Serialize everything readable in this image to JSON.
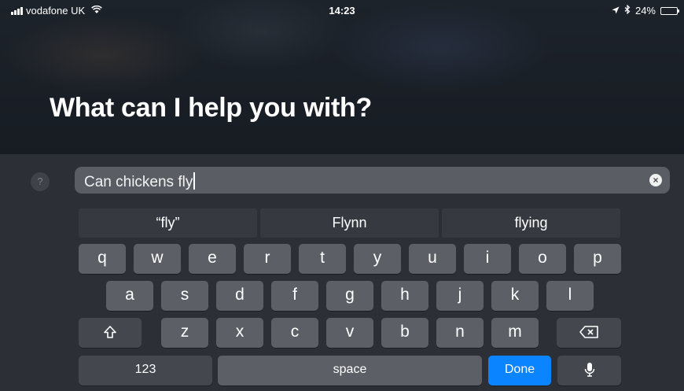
{
  "status_bar": {
    "carrier": "vodafone UK",
    "time": "14:23",
    "battery_percent": "24%",
    "battery_level": 0.24,
    "icons": [
      "signal-icon",
      "wifi-icon",
      "location-icon",
      "bluetooth-icon",
      "battery-icon"
    ]
  },
  "siri": {
    "prompt": "What can I help you with?",
    "help_glyph": "?",
    "search_text": "Can chickens fly"
  },
  "suggestions": [
    "“fly”",
    "Flynn",
    "flying"
  ],
  "keyboard": {
    "row1": [
      "q",
      "w",
      "e",
      "r",
      "t",
      "y",
      "u",
      "i",
      "o",
      "p"
    ],
    "row2": [
      "a",
      "s",
      "d",
      "f",
      "g",
      "h",
      "j",
      "k",
      "l"
    ],
    "row3": [
      "z",
      "x",
      "c",
      "v",
      "b",
      "n",
      "m"
    ],
    "numbers_label": "123",
    "space_label": "space",
    "done_label": "Done"
  },
  "colors": {
    "done_key": "#0a84ff",
    "key": "#5c6066",
    "panel": "#2c3036"
  }
}
